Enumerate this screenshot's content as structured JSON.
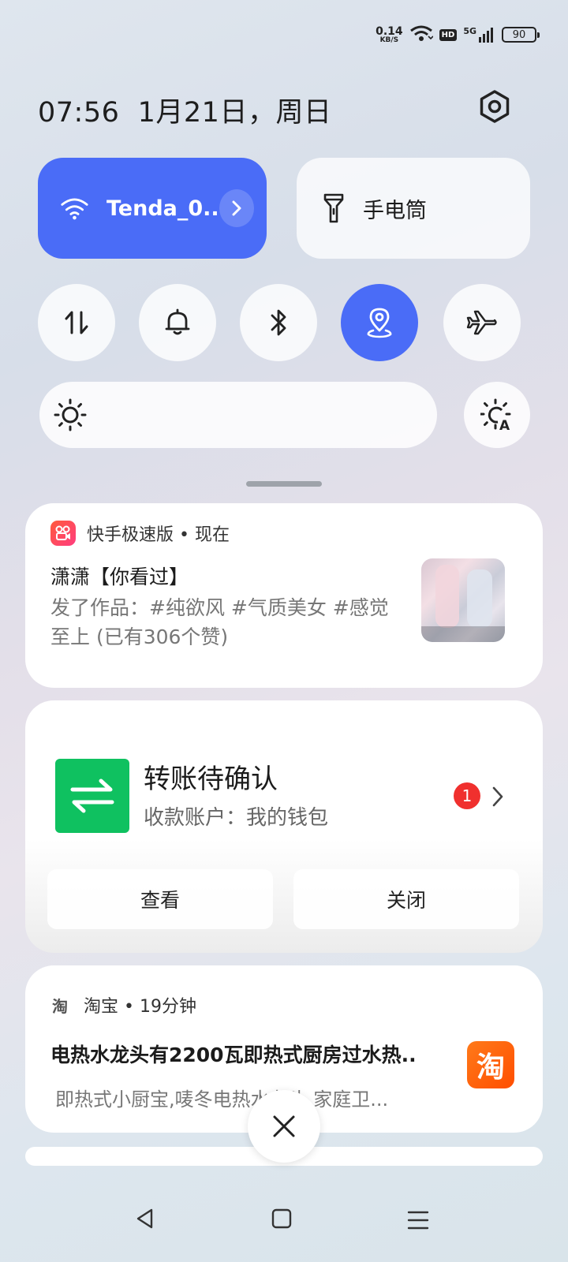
{
  "status_bar": {
    "net_speed_value": "0.14",
    "net_speed_unit": "KB/S",
    "hd": "HD",
    "signal_label": "5G",
    "battery": "90"
  },
  "header": {
    "time": "07:56",
    "date": "1月21日，周日"
  },
  "quick_tiles": {
    "wifi_name": "Tenda_0..",
    "torch_label": "手电筒"
  },
  "notifications": [
    {
      "app": "快手极速版",
      "separator": " • ",
      "time": "现在",
      "title": "潇潇【你看过】",
      "body": "发了作品：#纯欲风 #气质美女 #感觉至上 (已有306个赞)"
    },
    {
      "title": "转账待确认",
      "subtitle": "收款账户：我的钱包",
      "badge": "1",
      "action_view": "查看",
      "action_close": "关闭"
    },
    {
      "app": "淘宝",
      "app_icon_text": "淘",
      "separator": " • ",
      "time": "19分钟",
      "title": "电热水龙头有2200瓦即热式厨房过水热..",
      "body": "即热式小厨宝,唛冬电热水龙头,家庭卫...",
      "icon_text": "淘"
    }
  ],
  "colors": {
    "accent": "#4a6cf7",
    "wechat_green": "#0fc160",
    "badge_red": "#f0302e",
    "taobao_orange": "#ff5500"
  }
}
